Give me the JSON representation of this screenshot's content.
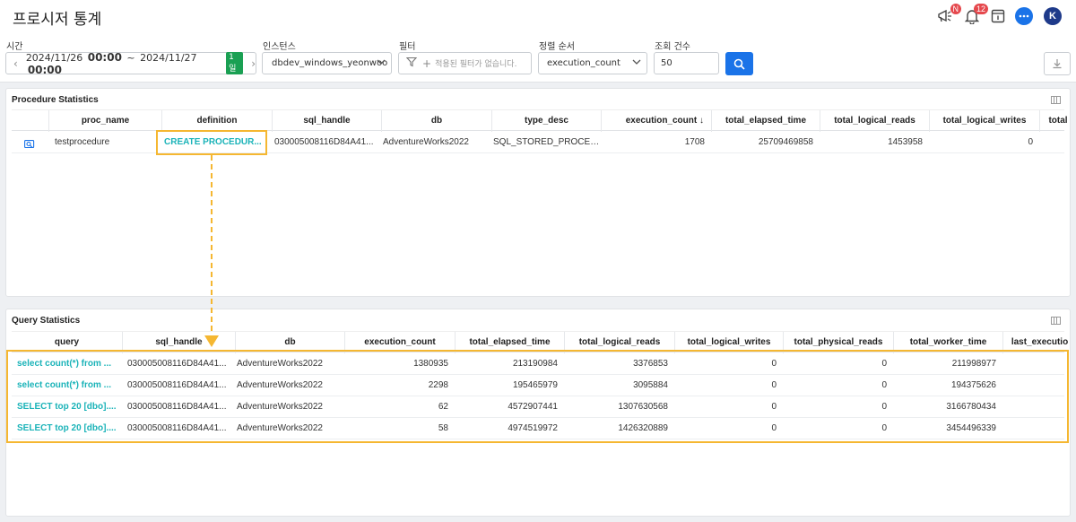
{
  "header": {
    "title": "프로시저 통계",
    "notice_badge": "N",
    "alert_badge": "12",
    "avatar_letter": "K"
  },
  "filters": {
    "time_label": "시간",
    "start_date": "2024/11/26",
    "start_time": "00:00",
    "separator": "~",
    "end_date": "2024/11/27",
    "end_time": "00:00",
    "range_badge": "1일",
    "instance_label": "인스턴스",
    "instance_value": "dbdev_windows_yeonwoo",
    "filter_label": "필터",
    "filter_placeholder": "적용된 필터가 없습니다.",
    "sort_label": "정렬 순서",
    "sort_value": "execution_count",
    "count_label": "조회 건수",
    "count_value": "50"
  },
  "procedure_panel": {
    "title": "Procedure Statistics",
    "columns": [
      "proc_name",
      "definition",
      "sql_handle",
      "db",
      "type_desc",
      "execution_count",
      "total_elapsed_time",
      "total_logical_reads",
      "total_logical_writes",
      "total"
    ],
    "sort_indicator": "↓",
    "rows": [
      {
        "proc_name": "testprocedure",
        "definition": "CREATE PROCEDUR...",
        "sql_handle": "030005008116D84A41...",
        "db": "AdventureWorks2022",
        "type_desc": "SQL_STORED_PROCED...",
        "execution_count": "1708",
        "total_elapsed_time": "25709469858",
        "total_logical_reads": "1453958",
        "total_logical_writes": "0"
      }
    ]
  },
  "query_panel": {
    "title": "Query Statistics",
    "columns": [
      "query",
      "sql_handle",
      "db",
      "execution_count",
      "total_elapsed_time",
      "total_logical_reads",
      "total_logical_writes",
      "total_physical_reads",
      "total_worker_time",
      "last_executio"
    ],
    "rows": [
      {
        "query": "select count(*) from ...",
        "sql_handle": "030005008116D84A41...",
        "db": "AdventureWorks2022",
        "execution_count": "1380935",
        "total_elapsed_time": "213190984",
        "total_logical_reads": "3376853",
        "total_logical_writes": "0",
        "total_physical_reads": "0",
        "total_worker_time": "211998977"
      },
      {
        "query": "select count(*) from ...",
        "sql_handle": "030005008116D84A41...",
        "db": "AdventureWorks2022",
        "execution_count": "2298",
        "total_elapsed_time": "195465979",
        "total_logical_reads": "3095884",
        "total_logical_writes": "0",
        "total_physical_reads": "0",
        "total_worker_time": "194375626"
      },
      {
        "query": "SELECT top 20 [dbo]....",
        "sql_handle": "030005008116D84A41...",
        "db": "AdventureWorks2022",
        "execution_count": "62",
        "total_elapsed_time": "4572907441",
        "total_logical_reads": "1307630568",
        "total_logical_writes": "0",
        "total_physical_reads": "0",
        "total_worker_time": "3166780434"
      },
      {
        "query": "SELECT top 20 [dbo]....",
        "sql_handle": "030005008116D84A41...",
        "db": "AdventureWorks2022",
        "execution_count": "58",
        "total_elapsed_time": "4974519972",
        "total_logical_reads": "1426320889",
        "total_logical_writes": "0",
        "total_physical_reads": "0",
        "total_worker_time": "3454496339"
      }
    ]
  },
  "colors": {
    "accent": "#1a73e8",
    "link": "#1ab3b8",
    "highlight": "#f5b731",
    "badge": "#e5484d",
    "day_badge": "#1aa053"
  }
}
